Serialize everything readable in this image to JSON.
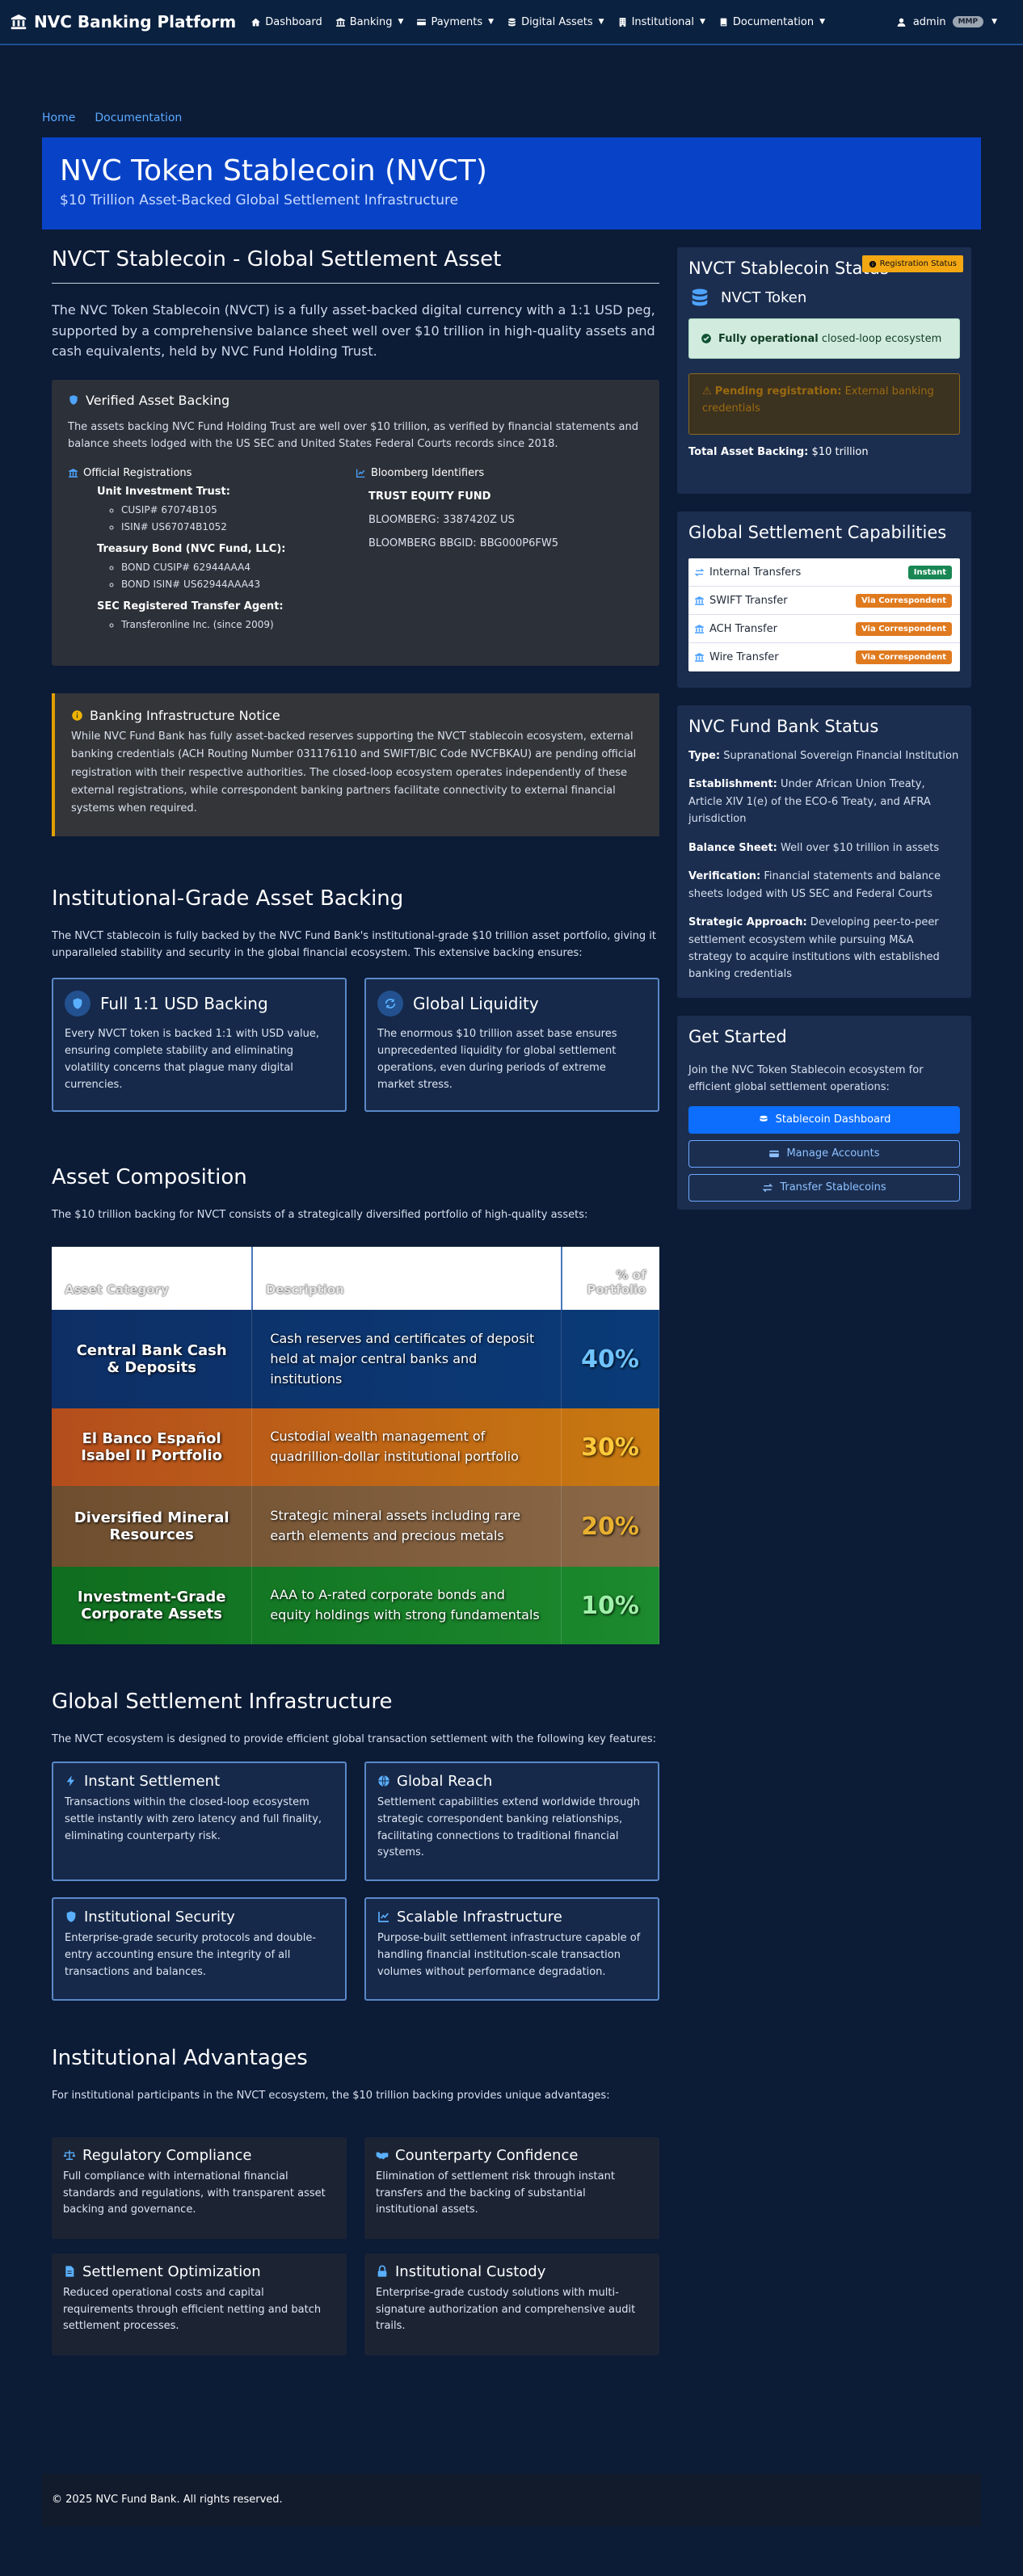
{
  "nav": {
    "brand": "NVC Banking Platform",
    "items": [
      {
        "label": "Dashboard",
        "icon": "home-icon",
        "dropdown": false
      },
      {
        "label": "Banking",
        "icon": "bank-icon",
        "dropdown": true
      },
      {
        "label": "Payments",
        "icon": "credit-card-icon",
        "dropdown": true
      },
      {
        "label": "Digital Assets",
        "icon": "coins-icon",
        "dropdown": true
      },
      {
        "label": "Institutional",
        "icon": "building-icon",
        "dropdown": true
      },
      {
        "label": "Documentation",
        "icon": "book-icon",
        "dropdown": true
      }
    ],
    "user": "admin",
    "role": "MMP"
  },
  "breadcrumb": [
    "Home",
    "Documentation"
  ],
  "hero": {
    "title": "NVC Token Stablecoin (NVCT)",
    "subtitle": "$10 Trillion Asset-Backed Global Settlement Infrastructure"
  },
  "main": {
    "title": "NVCT Stablecoin - Global Settlement Asset",
    "lead": "The NVC Token Stablecoin (NVCT) is a fully asset-backed digital currency with a 1:1 USD peg, supported by a comprehensive balance sheet well over $10 trillion in high-quality assets and cash equivalents, held by NVC Fund Holding Trust.",
    "verified": {
      "title": "Verified Asset Backing",
      "text": "The assets backing NVC Fund Holding Trust are well over $10 trillion, as verified by financial statements and balance sheets lodged with the US SEC and United States Federal Courts records since 2018.",
      "official_title": "Official Registrations",
      "uit_title": "Unit Investment Trust:",
      "uit_items": [
        "CUSIP# 67074B105",
        "ISIN# US67074B1052"
      ],
      "tb_title": "Treasury Bond (NVC Fund, LLC):",
      "tb_items": [
        "BOND CUSIP# 62944AAA4",
        "BOND ISIN# US62944AAA43"
      ],
      "sec_title": "SEC Registered Transfer Agent:",
      "sec_items": [
        "Transferonline Inc. (since 2009)"
      ],
      "bloomberg_title": "Bloomberg Identifiers",
      "bb_fund": "TRUST EQUITY FUND",
      "bb_line1": "BLOOMBERG: 3387420Z US",
      "bb_line2": "BLOOMBERG BBGID: BBG000P6FW5"
    },
    "notice": {
      "title": "Banking Infrastructure Notice",
      "text": "While NVC Fund Bank has fully asset-backed reserves supporting the NVCT stablecoin ecosystem, external banking credentials (ACH Routing Number 031176110 and SWIFT/BIC Code NVCFBKAU) are pending official registration with their respective authorities. The closed-loop ecosystem operates independently of these external registrations, while correspondent banking partners facilitate connectivity to external financial systems when required."
    },
    "backing": {
      "title": "Institutional-Grade Asset Backing",
      "text": "The NVCT stablecoin is fully backed by the NVC Fund Bank's institutional-grade $10 trillion asset portfolio, giving it unparalleled stability and security in the global financial ecosystem. This extensive backing ensures:",
      "cards": [
        {
          "title": "Full 1:1 USD Backing",
          "text": "Every NVCT token is backed 1:1 with USD value, ensuring complete stability and eliminating volatility concerns that plague many digital currencies."
        },
        {
          "title": "Global Liquidity",
          "text": "The enormous $10 trillion asset base ensures unprecedented liquidity for global settlement operations, even during periods of extreme market stress."
        }
      ]
    },
    "composition": {
      "title": "Asset Composition",
      "text": "The $10 trillion backing for NVCT consists of a strategically diversified portfolio of high-quality assets:",
      "headers": [
        "Asset Category",
        "Description",
        "% of Portfolio"
      ],
      "rows": [
        {
          "category": "Central Bank Cash & Deposits",
          "description": "Cash reserves and certificates of deposit held at major central banks and institutions",
          "percent": "40%",
          "pct_color": "#6fc3ff"
        },
        {
          "category": "El Banco Español Isabel II Portfolio",
          "description": "Custodial wealth management of quadrillion-dollar institutional portfolio",
          "percent": "30%",
          "pct_color": "#ffc83a"
        },
        {
          "category": "Diversified Mineral Resources",
          "description": "Strategic mineral assets including rare earth elements and precious metals",
          "percent": "20%",
          "pct_color": "#e8b030"
        },
        {
          "category": "Investment-Grade Corporate Assets",
          "description": "AAA to A-rated corporate bonds and equity holdings with strong fundamentals",
          "percent": "10%",
          "pct_color": "#9ff0a8"
        }
      ]
    },
    "infrastructure": {
      "title": "Global Settlement Infrastructure",
      "text": "The NVCT ecosystem is designed to provide efficient global transaction settlement with the following key features:",
      "cards": [
        {
          "title": "Instant Settlement",
          "text": "Transactions within the closed-loop ecosystem settle instantly with zero latency and full finality, eliminating counterparty risk."
        },
        {
          "title": "Global Reach",
          "text": "Settlement capabilities extend worldwide through strategic correspondent banking relationships, facilitating connections to traditional financial systems."
        },
        {
          "title": "Institutional Security",
          "text": "Enterprise-grade security protocols and double-entry accounting ensure the integrity of all transactions and balances."
        },
        {
          "title": "Scalable Infrastructure",
          "text": "Purpose-built settlement infrastructure capable of handling financial institution-scale transaction volumes without performance degradation."
        }
      ]
    },
    "advantages": {
      "title": "Institutional Advantages",
      "text": "For institutional participants in the NVCT ecosystem, the $10 trillion backing provides unique advantages:",
      "cards": [
        {
          "title": "Regulatory Compliance",
          "text": "Full compliance with international financial standards and regulations, with transparent asset backing and governance."
        },
        {
          "title": "Counterparty Confidence",
          "text": "Elimination of settlement risk through instant transfers and the backing of substantial institutional assets."
        },
        {
          "title": "Settlement Optimization",
          "text": "Reduced operational costs and capital requirements through efficient netting and batch settlement processes."
        },
        {
          "title": "Institutional Custody",
          "text": "Enterprise-grade custody solutions with multi-signature authorization and comprehensive audit trails."
        }
      ]
    }
  },
  "sidebar": {
    "status": {
      "title": "NVCT Stablecoin Status",
      "badge": "Registration Status",
      "token": "NVCT Token",
      "ok_bold": "Fully operational",
      "ok_rest": "closed-loop ecosystem",
      "warn_bold": "Pending registration:",
      "warn_rest": "External banking credentials",
      "total_label": "Total Asset Backing:",
      "total_value": "$10 trillion"
    },
    "settlement": {
      "title": "Global Settlement Capabilities",
      "items": [
        {
          "label": "Internal Transfers",
          "badge": "Instant",
          "badge_color": "green"
        },
        {
          "label": "SWIFT Transfer",
          "badge": "Via Correspondent",
          "badge_color": "orange"
        },
        {
          "label": "ACH Transfer",
          "badge": "Via Correspondent",
          "badge_color": "orange"
        },
        {
          "label": "Wire Transfer",
          "badge": "Via Correspondent",
          "badge_color": "orange"
        }
      ]
    },
    "bank": {
      "title": "NVC Fund Bank Status",
      "rows": [
        {
          "label": "Type:",
          "value": "Supranational Sovereign Financial Institution"
        },
        {
          "label": "Establishment:",
          "value": "Under African Union Treaty, Article XIV 1(e) of the ECO-6 Treaty, and AFRA jurisdiction"
        },
        {
          "label": "Balance Sheet:",
          "value": "Well over $10 trillion in assets"
        },
        {
          "label": "Verification:",
          "value": "Financial statements and balance sheets lodged with US SEC and Federal Courts"
        },
        {
          "label": "Strategic Approach:",
          "value": "Developing peer-to-peer settlement ecosystem while pursuing M&A strategy to acquire institutions with established banking credentials"
        }
      ]
    },
    "start": {
      "title": "Get Started",
      "text": "Join the NVC Token Stablecoin ecosystem for efficient global settlement operations:",
      "buttons": [
        "Stablecoin Dashboard",
        "Manage Accounts",
        "Transfer Stablecoins"
      ]
    }
  },
  "footer": {
    "copyright": "© 2025 NVC Fund Bank. All rights reserved."
  }
}
